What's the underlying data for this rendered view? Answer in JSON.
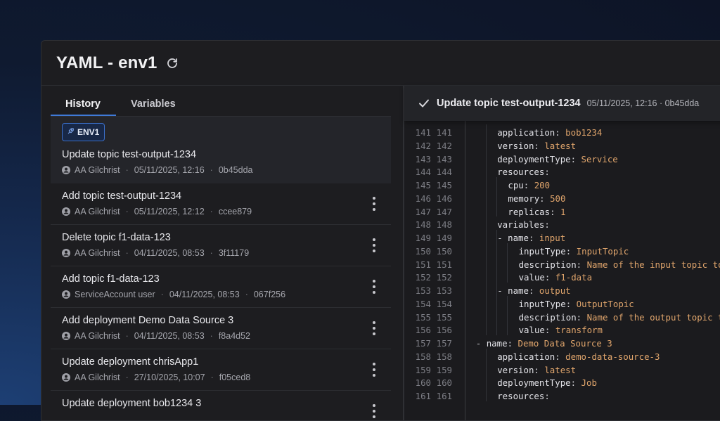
{
  "header": {
    "title": "YAML - env1"
  },
  "tabs": [
    {
      "label": "History"
    },
    {
      "label": "Variables"
    }
  ],
  "history": [
    {
      "badge": "ENV1",
      "title": "Update topic test-output-1234",
      "author": "AA Gilchrist",
      "date": "05/11/2025, 12:16",
      "hash": "0b45dda"
    },
    {
      "title": "Add topic test-output-1234",
      "author": "AA Gilchrist",
      "date": "05/11/2025, 12:12",
      "hash": "ccee879"
    },
    {
      "title": "Delete topic f1-data-123",
      "author": "AA Gilchrist",
      "date": "04/11/2025, 08:53",
      "hash": "3f11179"
    },
    {
      "title": "Add topic f1-data-123",
      "author": "ServiceAccount user",
      "date": "04/11/2025, 08:53",
      "hash": "067f256"
    },
    {
      "title": "Add deployment Demo Data Source 3",
      "author": "AA Gilchrist",
      "date": "04/11/2025, 08:53",
      "hash": "f8a4d52"
    },
    {
      "title": "Update deployment chrisApp1",
      "author": "AA Gilchrist",
      "date": "27/10/2025, 10:07",
      "hash": "f05ced8"
    },
    {
      "title": "Update deployment bob1234 3"
    }
  ],
  "commit": {
    "title": "Update topic test-output-1234",
    "meta": "05/11/2025, 12:16 · 0b45dda"
  },
  "code": [
    {
      "a": "141",
      "b": "141",
      "indent": 1,
      "key": "application",
      "val": "bob1234"
    },
    {
      "a": "142",
      "b": "142",
      "indent": 1,
      "key": "version",
      "val": "latest"
    },
    {
      "a": "143",
      "b": "143",
      "indent": 1,
      "key": "deploymentType",
      "val": "Service"
    },
    {
      "a": "144",
      "b": "144",
      "indent": 1,
      "key": "resources",
      "val": ""
    },
    {
      "a": "145",
      "b": "145",
      "indent": 2,
      "key": "cpu",
      "val": "200"
    },
    {
      "a": "146",
      "b": "146",
      "indent": 2,
      "key": "memory",
      "val": "500"
    },
    {
      "a": "147",
      "b": "147",
      "indent": 2,
      "key": "replicas",
      "val": "1"
    },
    {
      "a": "148",
      "b": "148",
      "indent": 1,
      "key": "variables",
      "val": ""
    },
    {
      "a": "149",
      "b": "149",
      "indent": 2,
      "dash": true,
      "key": "name",
      "val": "input"
    },
    {
      "a": "150",
      "b": "150",
      "indent": 3,
      "key": "inputType",
      "val": "InputTopic"
    },
    {
      "a": "151",
      "b": "151",
      "indent": 3,
      "key": "description",
      "val": "Name of the input topic to l"
    },
    {
      "a": "152",
      "b": "152",
      "indent": 3,
      "key": "value",
      "val": "f1-data"
    },
    {
      "a": "153",
      "b": "153",
      "indent": 2,
      "dash": true,
      "key": "name",
      "val": "output"
    },
    {
      "a": "154",
      "b": "154",
      "indent": 3,
      "key": "inputType",
      "val": "OutputTopic"
    },
    {
      "a": "155",
      "b": "155",
      "indent": 3,
      "key": "description",
      "val": "Name of the output topic to"
    },
    {
      "a": "156",
      "b": "156",
      "indent": 3,
      "key": "value",
      "val": "transform"
    },
    {
      "a": "157",
      "b": "157",
      "indent": 0,
      "dash": true,
      "key": "name",
      "val": "Demo Data Source 3"
    },
    {
      "a": "158",
      "b": "158",
      "indent": 1,
      "key": "application",
      "val": "demo-data-source-3"
    },
    {
      "a": "159",
      "b": "159",
      "indent": 1,
      "key": "version",
      "val": "latest"
    },
    {
      "a": "160",
      "b": "160",
      "indent": 1,
      "key": "deploymentType",
      "val": "Job"
    },
    {
      "a": "161",
      "b": "161",
      "indent": 1,
      "key": "resources",
      "val": ""
    }
  ]
}
